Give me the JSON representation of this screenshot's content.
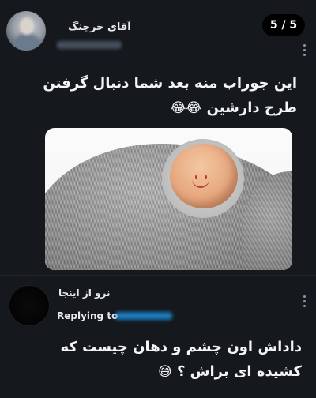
{
  "tweet1": {
    "author_name": "آقای خرچنگ",
    "pager": "5 / 5",
    "text_line1": "این جوراب منه بعد شما دنبال گرفتن",
    "text_line2": "طرح دارشین",
    "emoji": "😂😂"
  },
  "tweet2": {
    "author_name": "نرو از اینجا",
    "replying_label": "Replying to",
    "text_line1": "داداش اون چشم و دهان چیست که",
    "text_line2": "کشیده ای براش ؟",
    "emoji": "😅"
  },
  "icons": {
    "more": "more-vertical-icon"
  },
  "colors": {
    "background": "#15181c",
    "text": "#e7e9ea",
    "link": "#1d9bf0"
  }
}
